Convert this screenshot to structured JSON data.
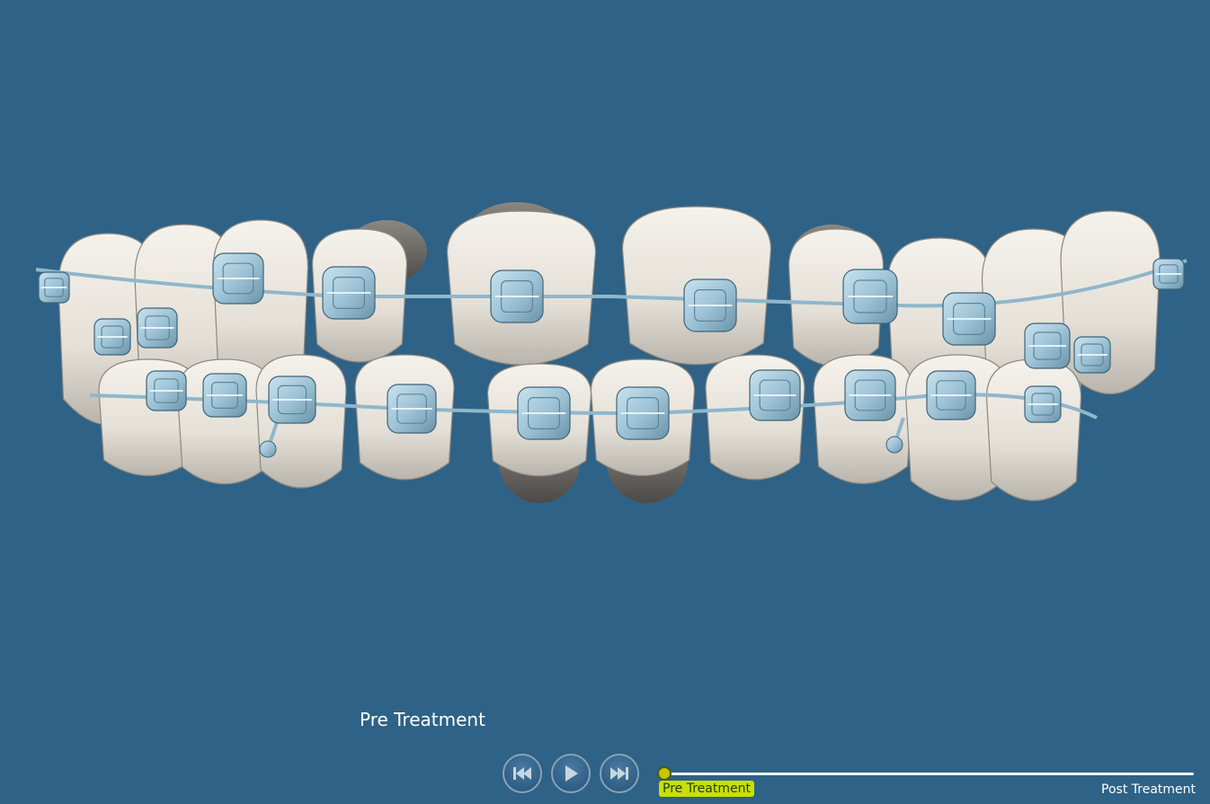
{
  "viewport": {
    "background_color": "#2e6286",
    "model_subject": "dental-arch-with-braces",
    "tooth_color": "#e9e6df",
    "bracket_color": "#9ec3d6",
    "wire_color": "#8fb7cc"
  },
  "stage_label": "Pre Treatment",
  "playback": {
    "rewind_icon": "skip-back-icon",
    "play_icon": "play-icon",
    "forward_icon": "skip-forward-icon"
  },
  "timeline": {
    "start_label": "Pre Treatment",
    "end_label": "Post Treatment",
    "progress": 0.0,
    "accent_color": "#c8e000"
  }
}
